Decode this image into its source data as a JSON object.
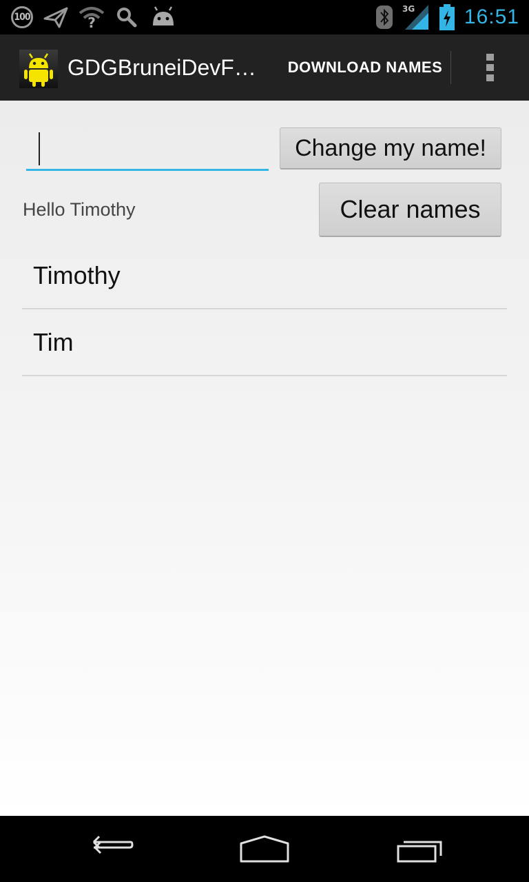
{
  "status_bar": {
    "battery_badge": "100",
    "network": "3G",
    "time": "16:51",
    "icons": [
      "hundred-badge-icon",
      "paper-plane-icon",
      "wifi-question-icon",
      "search-icon",
      "android-head-icon",
      "bluetooth-icon",
      "signal-icon",
      "battery-charging-icon"
    ]
  },
  "action_bar": {
    "title": "GDGBruneiDevF…",
    "download_label": "DOWNLOAD NAMES",
    "icons": [
      "android-app-icon",
      "overflow-menu-icon"
    ]
  },
  "form": {
    "name_input_value": "",
    "change_name_label": "Change my name!",
    "clear_names_label": "Clear names",
    "greeting": "Hello Timothy"
  },
  "names": [
    {
      "label": "Timothy"
    },
    {
      "label": "Tim"
    }
  ],
  "nav_bar": {
    "icons": [
      "back-icon",
      "home-icon",
      "recent-apps-icon"
    ]
  },
  "colors": {
    "accent": "#33b5e5",
    "action_bar": "#222222",
    "android_green": "#f5e400"
  }
}
